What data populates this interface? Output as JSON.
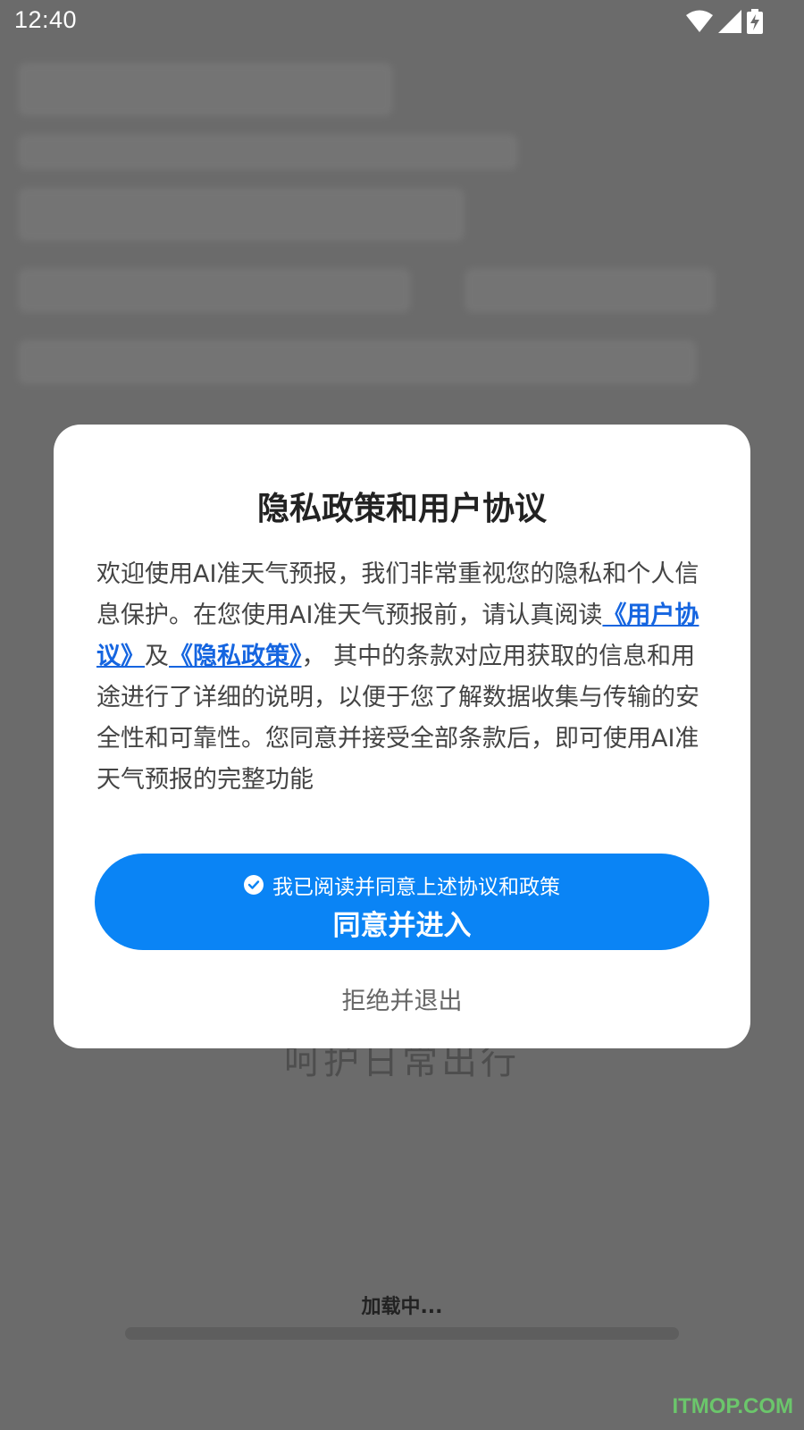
{
  "status_bar": {
    "time": "12:40",
    "icons": [
      "wifi-icon",
      "signal-icon",
      "battery-charging-icon"
    ]
  },
  "background": {
    "slogan": "呵护日常出行",
    "loading_text": "加载中...",
    "loading_progress": 0
  },
  "dialog": {
    "title": "隐私政策和用户协议",
    "body_part1": "欢迎使用AI准天气预报，我们非常重视您的隐私和个人信息保护。在您使用AI准天气预报前，请认真阅读",
    "user_agreement_link": "《用户协议》",
    "conjunction": "及",
    "privacy_policy_link": "《隐私政策》",
    "body_part2": "， 其中的条款对应用获取的信息和用途进行了详细的说明，以便于您了解数据收集与传输的安全性和可靠性。您同意并接受全部条款后，即可使用AI准天气预报的完整功能",
    "consent_text": "我已阅读并同意上述协议和政策",
    "agree_button": "同意并进入",
    "reject_button": "拒绝并退出"
  },
  "watermark": "ITMOP.COM",
  "colors": {
    "primary_button": "#0a84f5",
    "link": "#1565e0",
    "overlay": "#6b6b6b"
  }
}
